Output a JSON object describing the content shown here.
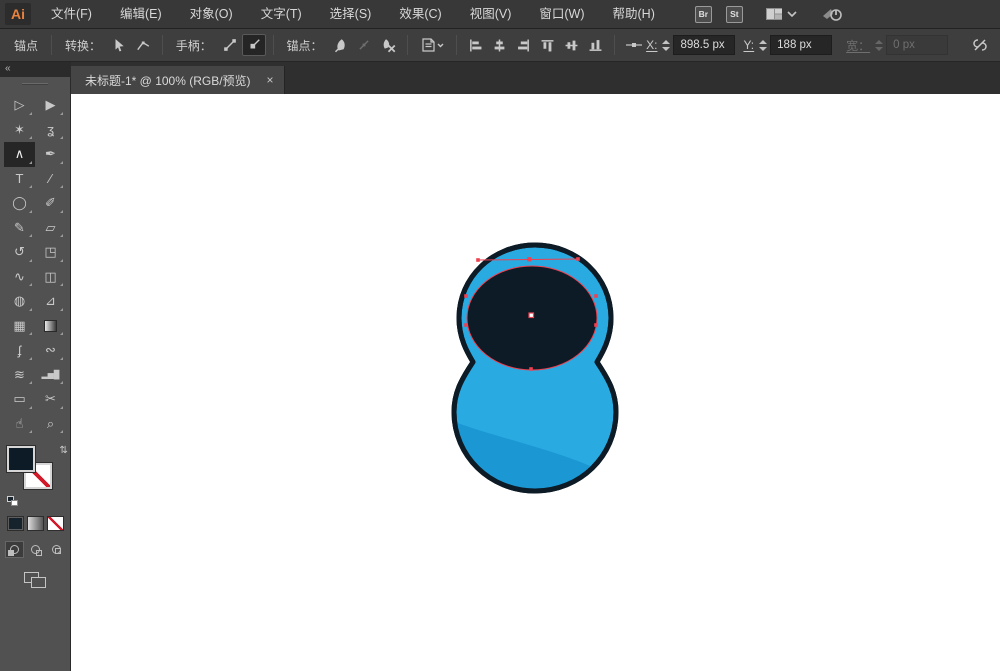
{
  "app": {
    "logo_text": "Ai"
  },
  "menubar": {
    "items": [
      {
        "label": "文件(F)"
      },
      {
        "label": "编辑(E)"
      },
      {
        "label": "对象(O)"
      },
      {
        "label": "文字(T)"
      },
      {
        "label": "选择(S)"
      },
      {
        "label": "效果(C)"
      },
      {
        "label": "视图(V)"
      },
      {
        "label": "窗口(W)"
      },
      {
        "label": "帮助(H)"
      }
    ],
    "bridge_label": "Br",
    "stock_label": "St"
  },
  "controlbar": {
    "context_label": "锚点",
    "convert_label": "转换：",
    "handles_label": "手柄：",
    "anchors_label": "锚点：",
    "x_label": "X:",
    "x_value": "898.5 px",
    "y_label": "Y:",
    "y_value": "188 px",
    "width_label": "宽：",
    "width_value": "0 px"
  },
  "document": {
    "tab_title": "未标题-1* @ 100% (RGB/预览)",
    "tab_close": "×",
    "zoom_level": "100%"
  },
  "dock": {
    "collapse_glyph": "«"
  },
  "tools": [
    {
      "name": "selection-tool",
      "glyph": "▷"
    },
    {
      "name": "direct-selection-tool",
      "glyph": "▶"
    },
    {
      "name": "magic-wand-tool",
      "glyph": "✶"
    },
    {
      "name": "lasso-tool",
      "glyph": "ʓ"
    },
    {
      "name": "anchor-point-tool",
      "glyph": "∧",
      "active": true
    },
    {
      "name": "pen-tool",
      "glyph": "✒"
    },
    {
      "name": "type-tool",
      "glyph": "T"
    },
    {
      "name": "line-segment-tool",
      "glyph": "∕"
    },
    {
      "name": "ellipse-tool",
      "glyph": "◯"
    },
    {
      "name": "paintbrush-tool",
      "glyph": "✐"
    },
    {
      "name": "pencil-tool",
      "glyph": "✎"
    },
    {
      "name": "eraser-tool",
      "glyph": "▱"
    },
    {
      "name": "rotate-tool",
      "glyph": "↺"
    },
    {
      "name": "scale-tool",
      "glyph": "◳"
    },
    {
      "name": "width-tool",
      "glyph": "∿"
    },
    {
      "name": "free-transform-tool",
      "glyph": "◫"
    },
    {
      "name": "shape-builder-tool",
      "glyph": "◍"
    },
    {
      "name": "perspective-grid-tool",
      "glyph": "⊿"
    },
    {
      "name": "mesh-tool",
      "glyph": "▦"
    },
    {
      "name": "gradient-tool",
      "glyph": ""
    },
    {
      "name": "eyedropper-tool",
      "glyph": "ʄ"
    },
    {
      "name": "blend-tool",
      "glyph": "∾"
    },
    {
      "name": "symbol-sprayer-tool",
      "glyph": "≋"
    },
    {
      "name": "column-graph-tool",
      "glyph": "▂▅█"
    },
    {
      "name": "artboard-tool",
      "glyph": "▭"
    },
    {
      "name": "slice-tool",
      "glyph": "✂"
    },
    {
      "name": "hand-tool",
      "glyph": "☝"
    },
    {
      "name": "zoom-tool",
      "glyph": "⌕"
    }
  ],
  "colors": {
    "artwork_body_blue": "#29abe2",
    "artwork_shade_blue": "#1b98d3",
    "artwork_dark_navy": "#0d1b26",
    "artwork_outline": "#0d1b26",
    "selection_red": "#ee4050",
    "fill_swatch": "#0d1b26",
    "stroke_swatch": "none",
    "canvas_white": "#ffffff"
  }
}
